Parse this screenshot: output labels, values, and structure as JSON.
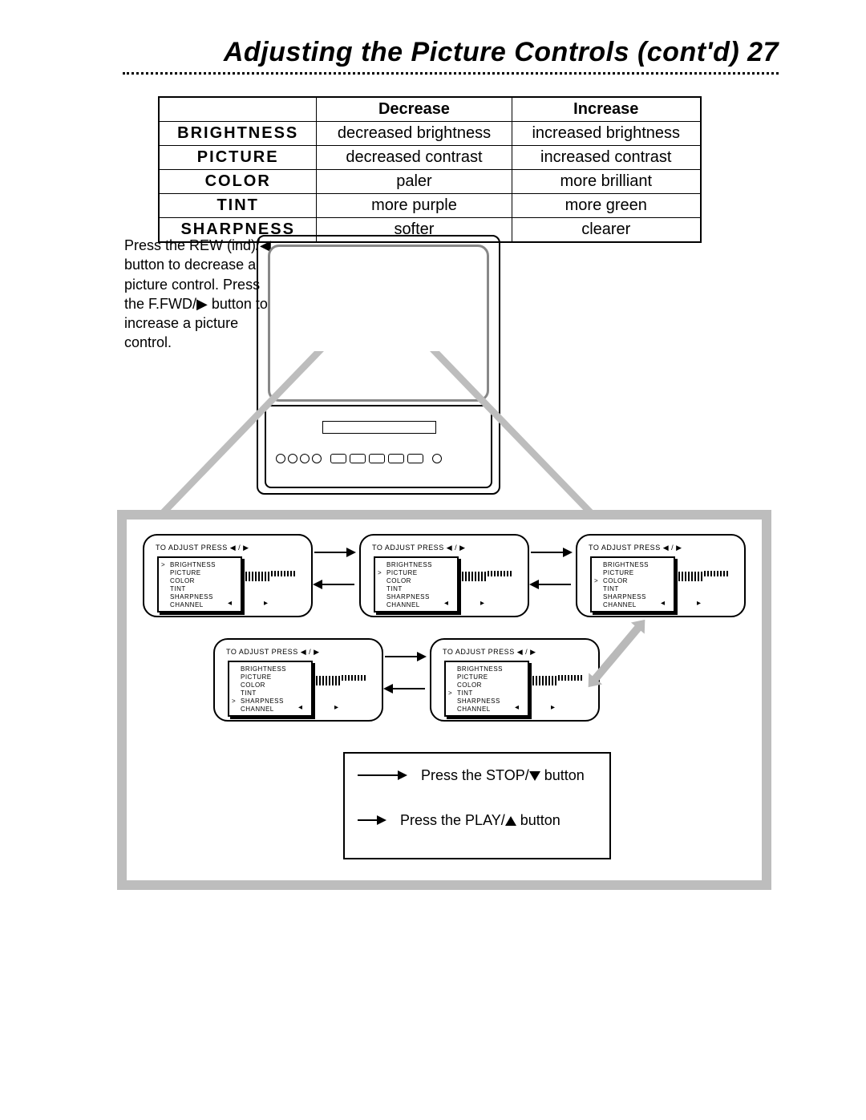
{
  "header": {
    "title": "Adjusting the Picture Controls (cont'd)",
    "page_number": "27"
  },
  "table": {
    "col_blank": "",
    "col_decrease": "Decrease",
    "col_increase": "Increase",
    "rows": [
      {
        "name": "BRIGHTNESS",
        "dec": "decreased brightness",
        "inc": "increased brightness"
      },
      {
        "name": "PICTURE",
        "dec": "decreased contrast",
        "inc": "increased contrast"
      },
      {
        "name": "COLOR",
        "dec": "paler",
        "inc": "more brilliant"
      },
      {
        "name": "TINT",
        "dec": "more purple",
        "inc": "more green"
      },
      {
        "name": "SHARPNESS",
        "dec": "softer",
        "inc": "clearer"
      }
    ]
  },
  "instruction": "Press the REW (ind)/◀ button to decrease a picture control. Press the F.FWD/▶ button to increase a picture control.",
  "osd": {
    "header": "TO ADJUST PRESS ◀ / ▶",
    "items": [
      "BRIGHTNESS",
      "PICTURE",
      "COLOR",
      "TINT",
      "SHARPNESS",
      "CHANNEL"
    ],
    "cards": [
      {
        "selected": "BRIGHTNESS"
      },
      {
        "selected": "PICTURE"
      },
      {
        "selected": "COLOR"
      },
      {
        "selected": "SHARPNESS"
      },
      {
        "selected": "TINT"
      }
    ]
  },
  "legend": {
    "stop": "Press the STOP/▼ button",
    "play": "Press the PLAY/▲ button"
  }
}
